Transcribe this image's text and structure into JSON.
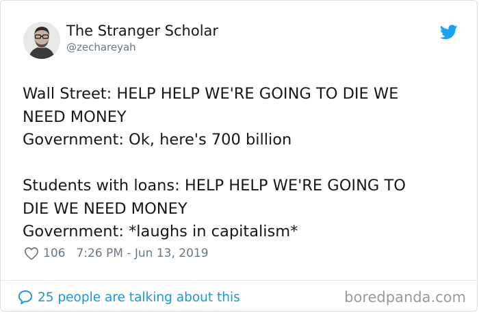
{
  "author": {
    "name": "The Stranger Scholar",
    "handle": "@zechareyah",
    "avatar_icon": "avatar-photo"
  },
  "brand": {
    "icon": "twitter-bird-icon",
    "accent": "#1da1f2"
  },
  "tweet": {
    "paragraph1": [
      "Wall Street: HELP HELP WE'RE GOING TO DIE WE",
      "NEED MONEY",
      "Government: Ok, here's 700 billion"
    ],
    "paragraph2": [
      "Students with loans: HELP HELP WE'RE GOING TO",
      "DIE WE NEED MONEY",
      "Government: *laughs in capitalism*"
    ]
  },
  "meta": {
    "likes": "106",
    "timestamp": "7:26 PM - Jun 13, 2019"
  },
  "footer": {
    "talking": "25 people are talking about this",
    "watermark": "boredpanda.com",
    "link_color": "#1b95e0"
  }
}
